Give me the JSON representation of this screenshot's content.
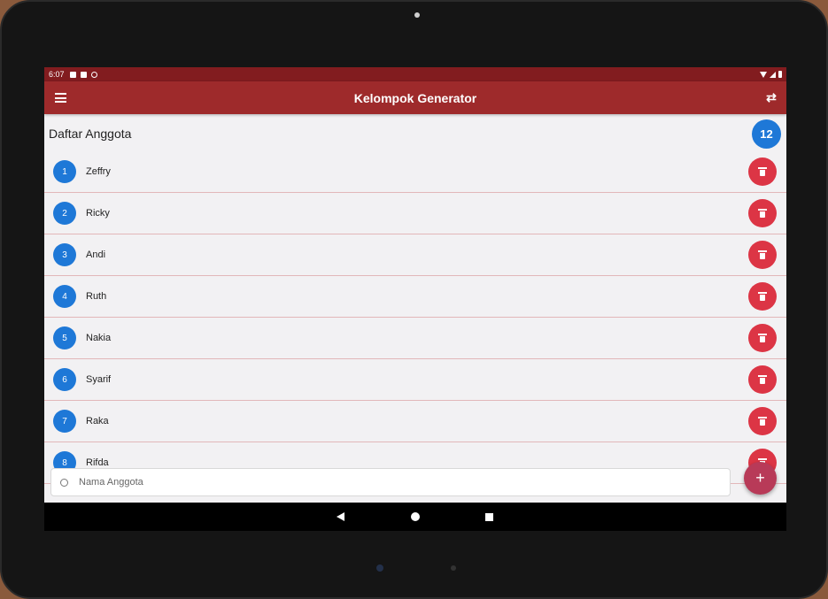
{
  "status_bar": {
    "time": "6:07"
  },
  "app_bar": {
    "title": "Kelompok Generator",
    "menu_icon": "menu-icon",
    "action_icon": "shuffle-icon"
  },
  "header": {
    "heading": "Daftar Anggota",
    "member_count": "12"
  },
  "members": [
    {
      "number": "1",
      "name": "Zeffry"
    },
    {
      "number": "2",
      "name": "Ricky"
    },
    {
      "number": "3",
      "name": "Andi"
    },
    {
      "number": "4",
      "name": "Ruth"
    },
    {
      "number": "5",
      "name": "Nakia"
    },
    {
      "number": "6",
      "name": "Syarif"
    },
    {
      "number": "7",
      "name": "Raka"
    },
    {
      "number": "8",
      "name": "Rifda"
    }
  ],
  "input": {
    "placeholder": "Nama Anggota",
    "value": ""
  },
  "fab": {
    "label": "+"
  },
  "colors": {
    "app_bar": "#9e2a2b",
    "status_bar": "#821c1f",
    "accent_blue": "#1e78d7",
    "delete_red": "#dc3545",
    "fab": "#b83a58"
  }
}
